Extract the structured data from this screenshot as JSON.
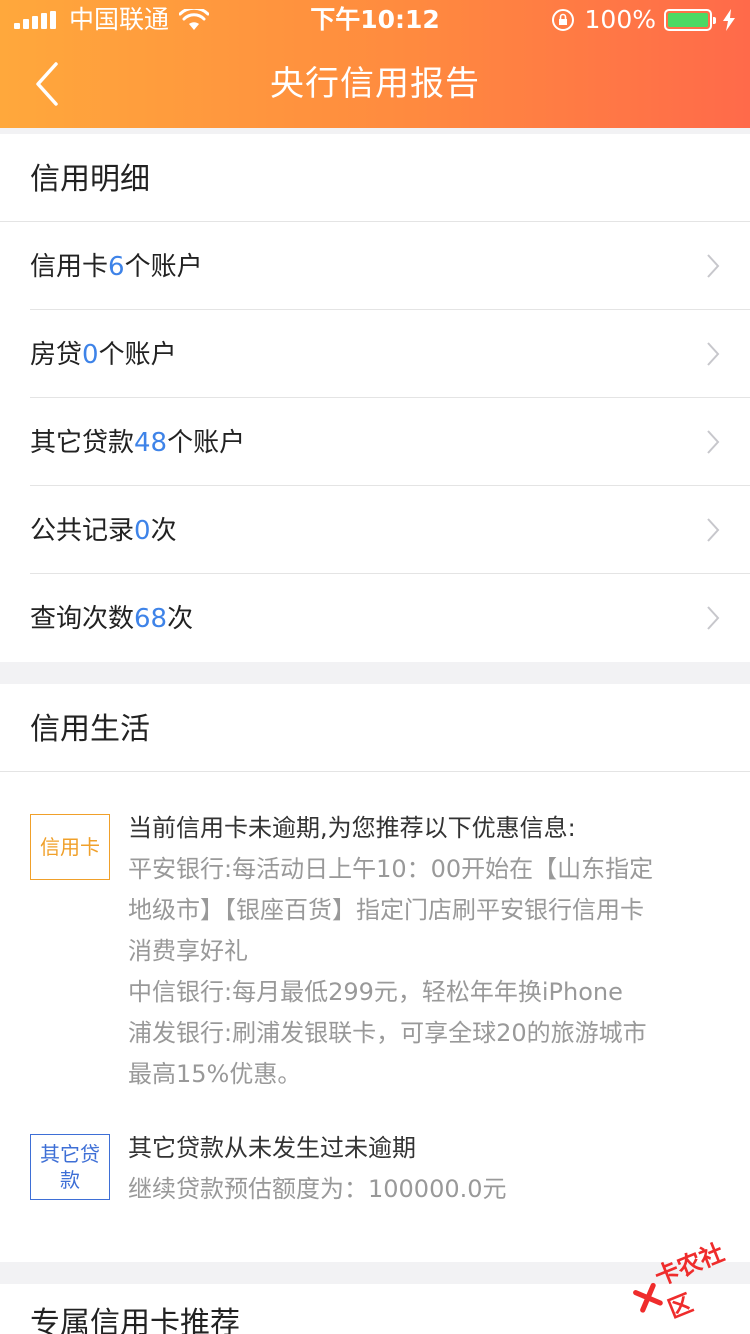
{
  "status_bar": {
    "carrier": "中国联通",
    "time": "下午10:12",
    "battery": "100%",
    "battery_level": 1.0
  },
  "nav": {
    "title": "央行信用报告",
    "back_icon": "chevron-left-icon"
  },
  "credit_detail": {
    "title": "信用明细",
    "rows": [
      {
        "prefix": "信用卡",
        "count": "6",
        "suffix": "个账户"
      },
      {
        "prefix": "房贷",
        "count": "0",
        "suffix": "个账户"
      },
      {
        "prefix": "其它贷款",
        "count": "48",
        "suffix": "个账户"
      },
      {
        "prefix": "公共记录",
        "count": "0",
        "suffix": "次"
      },
      {
        "prefix": "查询次数",
        "count": "68",
        "suffix": "次"
      }
    ]
  },
  "credit_life": {
    "title": "信用生活",
    "items": [
      {
        "badge": "信用卡",
        "main": "当前信用卡未逾期,为您推荐以下优惠信息:",
        "lines": [
          "平安银行:每活动日上午10：00开始在【山东指定",
          "地级市】【银座百货】指定门店刷平安银行信用卡",
          "消费享好礼",
          "中信银行:每月最低299元，轻松年年换iPhone",
          "浦发银行:刷浦发银联卡，可享全球20的旅游城市",
          "最高15%优惠。"
        ]
      },
      {
        "badge": "其它贷款",
        "main": "其它贷款从未发生过未逾期",
        "lines": [
          "继续贷款预估额度为：100000.0元"
        ]
      }
    ]
  },
  "recommend": {
    "title": "专属信用卡推荐"
  },
  "watermark": {
    "text": "卡农社区"
  },
  "colors": {
    "header_start": "#ffa83c",
    "header_end": "#ff6a4a",
    "count_blue": "#3e83e8",
    "badge_orange": "#f0a02a",
    "badge_blue": "#3e6fd6"
  }
}
